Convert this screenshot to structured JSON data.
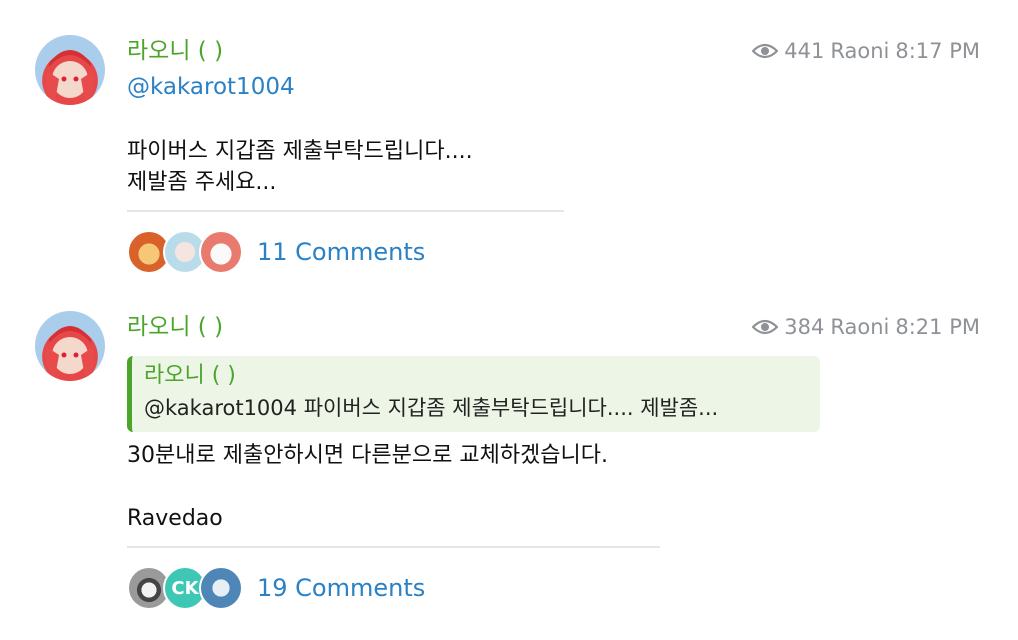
{
  "posts": [
    {
      "sender": "라오니 ( )",
      "views": "441",
      "author": "Raoni",
      "time": "8:17 PM",
      "mention": "@kakarot1004",
      "lines": [
        "파이버스 지갑좀 제출부탁드립니다....",
        "제발좀 주세요..."
      ],
      "comments_label": "11 Comments"
    },
    {
      "sender": "라오니 ( )",
      "views": "384",
      "author": "Raoni",
      "time": "8:21 PM",
      "reply": {
        "sender": "라오니 ( )",
        "text": "@kakarot1004  파이버스 지갑좀 제출부탁드립니다.... 제발좀..."
      },
      "lines": [
        "30분내로 제출안하시면 다른분으로 교체하겠습니다.",
        "",
        "Ravedao"
      ],
      "comments_label": "19 Comments",
      "commenter_initials": "CK"
    }
  ],
  "icons": {
    "views": "eye-icon"
  },
  "colors": {
    "sender": "#4aa52a",
    "link": "#2a81c5",
    "meta": "#8e9297",
    "reply_bg": "#ecf5e6"
  }
}
